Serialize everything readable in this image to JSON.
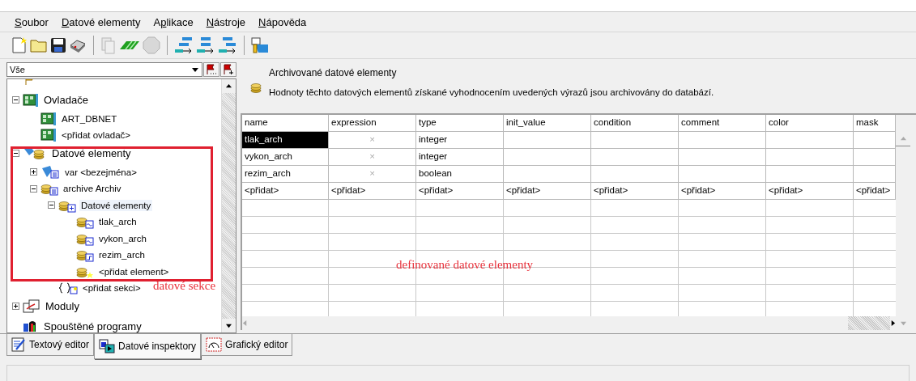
{
  "menu": [
    {
      "key": "S",
      "post": "oubor"
    },
    {
      "key": "D",
      "post": "atové elementy"
    },
    {
      "pre": "A",
      "key": "p",
      "post": "likace"
    },
    {
      "key": "N",
      "post": "ástroje"
    },
    {
      "key": "N",
      "post": "ápověda"
    }
  ],
  "toolbar": [
    {
      "kind": "new",
      "disabled": false
    },
    {
      "kind": "open",
      "disabled": false
    },
    {
      "kind": "save",
      "disabled": false
    },
    {
      "kind": "print",
      "disabled": false
    },
    {
      "kind": "separator"
    },
    {
      "kind": "preview",
      "disabled": true
    },
    {
      "kind": "run",
      "disabled": false
    },
    {
      "kind": "stop",
      "disabled": true
    },
    {
      "kind": "separator"
    },
    {
      "kind": "layout-a",
      "disabled": false
    },
    {
      "kind": "layout-b",
      "disabled": false
    },
    {
      "kind": "layout-c",
      "disabled": false
    },
    {
      "kind": "separator"
    },
    {
      "kind": "tool",
      "disabled": false
    }
  ],
  "filter": {
    "value": "Vše"
  },
  "tree": [
    {
      "kind": "flag"
    },
    {
      "kind": "controller",
      "label": "Ovladače",
      "selected": false,
      "expanded": true,
      "children": [
        {
          "kind": "controller",
          "label": "ART_DBNET",
          "selected": false
        },
        {
          "kind": "controller",
          "label": "<přidat ovladač>",
          "selected": false
        }
      ]
    },
    {
      "kind": "data",
      "label": "Datové elementy",
      "selected": false,
      "expanded": true,
      "children": [
        {
          "kind": "var",
          "label": "var <bezejména>",
          "selected": false,
          "expanded": false
        },
        {
          "kind": "archive",
          "label": "archive Archiv",
          "selected": false,
          "expanded": true,
          "children": [
            {
              "kind": "section",
              "label": "Datové elementy",
              "selected": true,
              "expanded": true,
              "children": [
                {
                  "kind": "wave",
                  "label": "tlak_arch",
                  "selected": false
                },
                {
                  "kind": "wave",
                  "label": "vykon_arch",
                  "selected": false
                },
                {
                  "kind": "step",
                  "label": "rezim_arch",
                  "selected": false
                },
                {
                  "kind": "add-element",
                  "label": "<přidat element>",
                  "selected": false
                }
              ]
            },
            {
              "kind": "add-section",
              "label": "<přidat sekci>",
              "selected": false
            }
          ]
        }
      ]
    },
    {
      "kind": "modules",
      "label": "Moduly",
      "selected": false,
      "expanded": false
    },
    {
      "kind": "programs",
      "label": "Spouštěné programy",
      "selected": false
    }
  ],
  "tree_frame": true,
  "tree_note": "datové sekce",
  "header": {
    "title": "Archivované datové elementy",
    "description": "Hodnoty těchto datových elementů získané vyhodnocením uvedených výrazů jsou archivovány do databází."
  },
  "table": {
    "columns": [
      "name",
      "expression",
      "type",
      "init_value",
      "condition",
      "comment",
      "color",
      "mask"
    ],
    "rows": [
      {
        "selected": true,
        "cells": [
          "tlak_arch",
          "×",
          "integer",
          "",
          "",
          "",
          "",
          ""
        ]
      },
      {
        "selected": false,
        "cells": [
          "vykon_arch",
          "×",
          "integer",
          "",
          "",
          "",
          "",
          ""
        ]
      },
      {
        "selected": false,
        "cells": [
          "rezim_arch",
          "×",
          "boolean",
          "",
          "",
          "",
          "",
          ""
        ]
      },
      {
        "selected": false,
        "cells": [
          "<přidat>",
          "<přidat>",
          "<přidat>",
          "<přidat>",
          "<přidat>",
          "<přidat>",
          "<přidat>",
          "<přidat>"
        ]
      }
    ]
  },
  "table_note": "definované datové elementy",
  "tabs": [
    {
      "label": "Textový editor",
      "kind": "text",
      "selected": false
    },
    {
      "label": "Datové inspektory",
      "kind": "inspect",
      "selected": true
    },
    {
      "label": "Grafický editor",
      "kind": "graphic",
      "selected": false
    }
  ]
}
